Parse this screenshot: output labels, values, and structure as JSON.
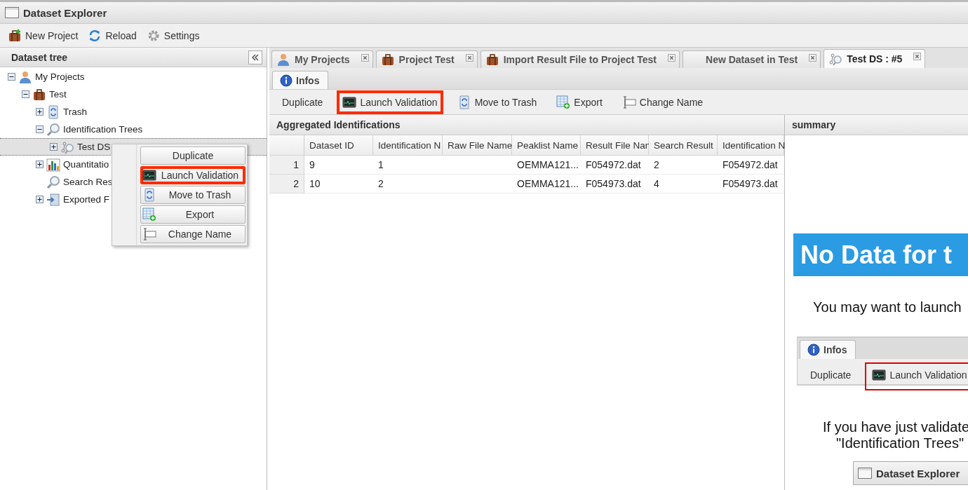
{
  "window": {
    "title": "Dataset Explorer"
  },
  "toolbar": [
    {
      "label": "New Project",
      "kind": "new-project"
    },
    {
      "label": "Reload",
      "kind": "reload"
    },
    {
      "label": "Settings",
      "kind": "settings"
    }
  ],
  "tree_panel": {
    "title": "Dataset tree",
    "nodes": [
      {
        "label": "My Projects",
        "kind": "user",
        "expanded": true,
        "selected": false,
        "children": [
          {
            "label": "Test",
            "kind": "project",
            "expanded": true,
            "selected": false,
            "children": [
              {
                "label": "Trash",
                "kind": "trash",
                "expanded": false,
                "selected": false
              },
              {
                "label": "Identification Trees",
                "kind": "search",
                "expanded": true,
                "selected": false,
                "children": [
                  {
                    "label": "Test DS",
                    "kind": "dataset",
                    "expanded": false,
                    "selected": true
                  }
                ]
              },
              {
                "label": "Quantitatio",
                "kind": "chart",
                "expanded": false,
                "selected": false
              },
              {
                "label": "Search Res",
                "kind": "search",
                "selected": false
              },
              {
                "label": "Exported F",
                "kind": "export",
                "expanded": false,
                "selected": false
              }
            ]
          }
        ]
      }
    ]
  },
  "context_menu": {
    "items": [
      {
        "label": "Duplicate",
        "kind": "none",
        "highlighted": false
      },
      {
        "label": "Launch Validation",
        "kind": "validate",
        "highlighted": true
      },
      {
        "label": "Move to Trash",
        "kind": "trash",
        "highlighted": false
      },
      {
        "label": "Export",
        "kind": "table",
        "highlighted": false
      },
      {
        "label": "Change Name",
        "kind": "rename",
        "highlighted": false
      }
    ]
  },
  "tabs": [
    {
      "label": "My Projects",
      "kind": "user",
      "selected": false
    },
    {
      "label": "Project Test",
      "kind": "project",
      "selected": false
    },
    {
      "label": "Import Result File to Project Test",
      "kind": "project",
      "selected": false
    },
    {
      "label": "New Dataset in Test",
      "kind": "none",
      "selected": false
    },
    {
      "label": "Test DS : #5",
      "kind": "dataset",
      "selected": true
    }
  ],
  "subtabs": [
    {
      "label": "Infos",
      "selected": true
    }
  ],
  "actions": [
    {
      "label": "Duplicate",
      "kind": "none",
      "highlighted": false
    },
    {
      "label": "Launch Validation",
      "kind": "validate",
      "highlighted": true
    },
    {
      "label": "Move to Trash",
      "kind": "trash",
      "highlighted": false
    },
    {
      "label": "Export",
      "kind": "table",
      "highlighted": false
    },
    {
      "label": "Change Name",
      "kind": "rename",
      "highlighted": false
    }
  ],
  "table": {
    "title": "Aggregated Identifications",
    "columns": [
      "Dataset ID",
      "Identification N",
      "Raw File Name",
      "Peaklist Name",
      "Result File Nan",
      "Search Result",
      "Identification N"
    ],
    "rows": [
      {
        "index": "1",
        "cells": [
          "9",
          "1",
          null,
          "OEMMA121...",
          "F054972.dat",
          "2",
          "F054972.dat"
        ]
      },
      {
        "index": "2",
        "cells": [
          "10",
          "2",
          null,
          "OEMMA121...",
          "F054973.dat",
          "4",
          "F054973.dat"
        ]
      }
    ]
  },
  "summary": {
    "title": "summary",
    "banner": "No Data for t",
    "intro": "You may want to launch",
    "example": {
      "tab": "Infos",
      "actions": [
        {
          "label": "Duplicate",
          "kind": "none",
          "highlighted": false
        },
        {
          "label": "Launch Validation",
          "kind": "validate",
          "highlighted": true
        }
      ]
    },
    "note_lines": [
      "If you have just validate",
      "\"Identification Trees\""
    ],
    "example_window": {
      "title": "Dataset Explorer"
    }
  }
}
